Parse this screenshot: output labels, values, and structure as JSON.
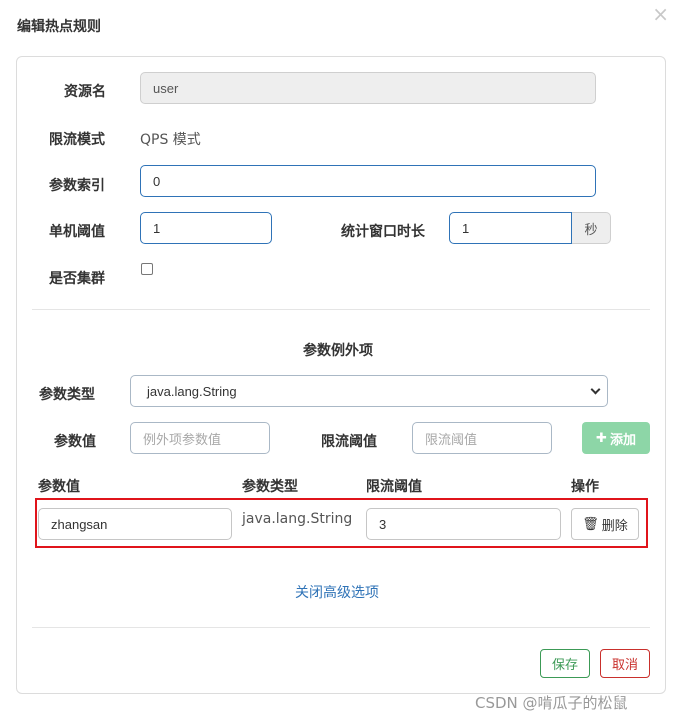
{
  "dialog": {
    "title": "编辑热点规则",
    "close_glyph": "×"
  },
  "form": {
    "resource_label": "资源名",
    "resource_value": "user",
    "mode_label": "限流模式",
    "mode_value": "QPS 模式",
    "param_index_label": "参数索引",
    "param_index_value": "0",
    "threshold_label": "单机阈值",
    "threshold_value": "1",
    "window_label": "统计窗口时长",
    "window_value": "1",
    "window_unit": "秒",
    "cluster_label": "是否集群",
    "cluster_checked": false
  },
  "exceptions": {
    "section_title": "参数例外项",
    "type_label": "参数类型",
    "type_selected": "java.lang.String",
    "value_label": "参数值",
    "value_placeholder": "例外项参数值",
    "limit_label": "限流阈值",
    "limit_placeholder": "限流阈值",
    "add_button": "添加",
    "add_icon": "plus-icon",
    "table": {
      "headers": [
        "参数值",
        "参数类型",
        "限流阈值",
        "操作"
      ],
      "rows": [
        {
          "value": "zhangsan",
          "type": "java.lang.String",
          "limit": "3",
          "action": "删除"
        }
      ]
    }
  },
  "advanced_link": "关闭高级选项",
  "footer": {
    "save": "保存",
    "cancel": "取消"
  },
  "watermark": "CSDN @啃瓜子的松鼠",
  "colors": {
    "primary": "#2f73b7",
    "success": "#3c9a56",
    "danger": "#c9302c",
    "highlight_frame": "#e0141b"
  }
}
